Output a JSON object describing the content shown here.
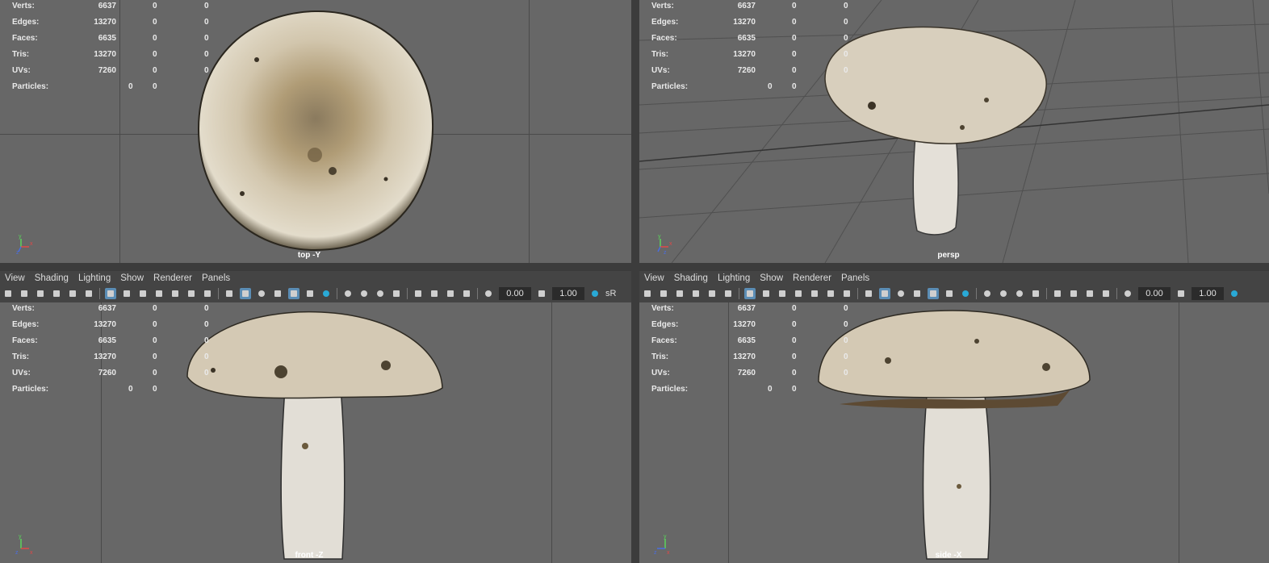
{
  "menu": [
    "View",
    "Shading",
    "Lighting",
    "Show",
    "Renderer",
    "Panels"
  ],
  "toolbar": {
    "exposure": "0.00",
    "gamma": "1.00",
    "color_space": "sR"
  },
  "stats_labels": [
    "Verts:",
    "Edges:",
    "Faces:",
    "Tris:",
    "UVs:",
    "Particles:"
  ],
  "stats": [
    [
      "6637",
      "0",
      "0"
    ],
    [
      "13270",
      "0",
      "0"
    ],
    [
      "6635",
      "0",
      "0"
    ],
    [
      "13270",
      "0",
      "0"
    ],
    [
      "7260",
      "0",
      "0"
    ],
    [
      "",
      "0",
      "0"
    ]
  ],
  "viewports": {
    "top": {
      "label": "top -Y",
      "axis": [
        "y",
        "x",
        "z"
      ]
    },
    "persp": {
      "label": "persp",
      "axis": [
        "y",
        "x",
        "z"
      ]
    },
    "front": {
      "label": "front -Z",
      "axis": [
        "y",
        "z",
        "x"
      ]
    },
    "side": {
      "label": "side -X",
      "axis": [
        "y",
        "z",
        "x"
      ]
    }
  },
  "colors": {
    "viewport_bg": "#676767",
    "toolbar_bg": "#444444",
    "highlight": "#5b8db5"
  },
  "icons": [
    "camera-icon",
    "grid-icon",
    "shaded-icon",
    "textured-icon",
    "light-icon",
    "shadow-icon",
    "isolate-icon"
  ]
}
